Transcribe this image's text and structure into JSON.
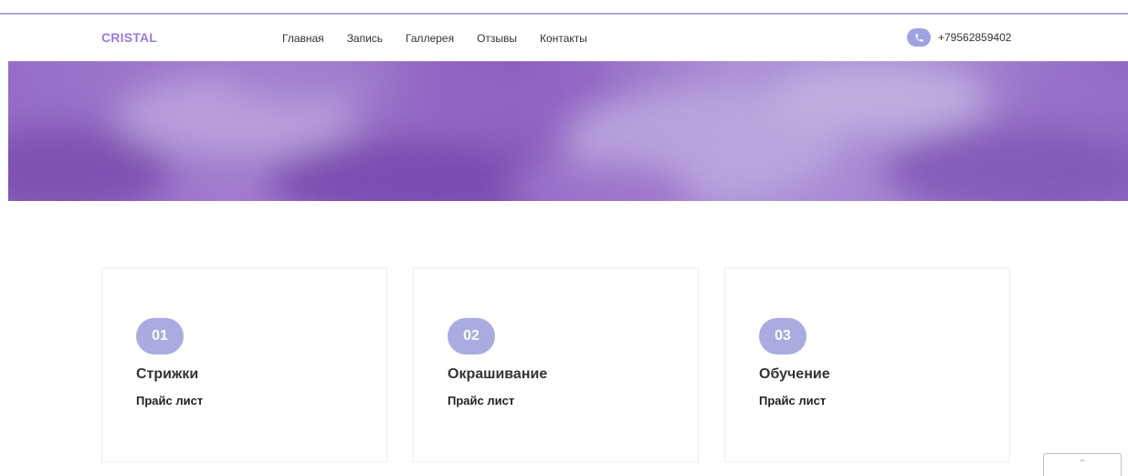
{
  "brand": {
    "logo": "CRISTAL",
    "accent_color": "#9a7cd8",
    "icon_color": "#a9abe1"
  },
  "nav": {
    "items": [
      {
        "label": "Главная"
      },
      {
        "label": "Запись"
      },
      {
        "label": "Галлерея"
      },
      {
        "label": "Отзывы"
      },
      {
        "label": "Контакты"
      }
    ]
  },
  "contact": {
    "phone": "+79562859402",
    "icon": "phone-icon"
  },
  "services": [
    {
      "number": "01",
      "title": "Стрижки",
      "link": "Прайс лист"
    },
    {
      "number": "02",
      "title": "Окрашивание",
      "link": "Прайс лист"
    },
    {
      "number": "03",
      "title": "Обучение",
      "link": "Прайс лист"
    }
  ],
  "scroll_top": {
    "icon": "chevron-up-icon",
    "glyph": "^"
  }
}
